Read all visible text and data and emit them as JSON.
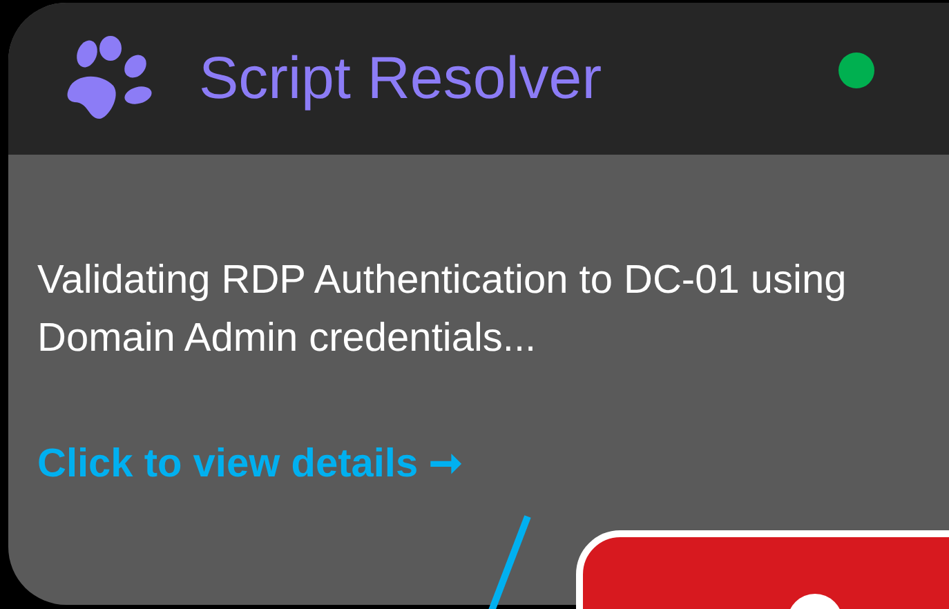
{
  "card": {
    "title": "Script Resolver",
    "online": true,
    "message": "Validating RDP Authentication to DC-01 using Domain Admin credentials...",
    "link": "Click to view details ➞"
  }
}
